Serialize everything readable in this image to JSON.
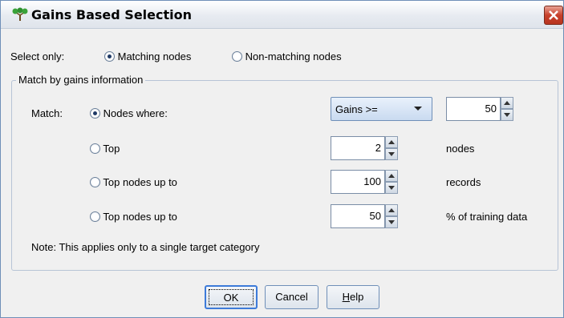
{
  "window": {
    "title": "Gains Based Selection"
  },
  "select_only": {
    "label": "Select only:",
    "options": [
      {
        "label": "Matching nodes",
        "checked": true
      },
      {
        "label": "Non-matching nodes",
        "checked": false
      }
    ]
  },
  "group": {
    "title": "Match by gains information",
    "match_label": "Match:",
    "rows": [
      {
        "label": "Nodes where:",
        "checked": true,
        "combo": "Gains >=",
        "value": "50"
      },
      {
        "label": "Top",
        "checked": false,
        "value": "2",
        "unit": "nodes"
      },
      {
        "label": "Top nodes up to",
        "checked": false,
        "value": "100",
        "unit": "records"
      },
      {
        "label": "Top nodes up to",
        "checked": false,
        "value": "50",
        "unit": "% of training data"
      }
    ],
    "note": "Note: This applies only to a single target category"
  },
  "buttons": {
    "ok": "OK",
    "cancel": "Cancel",
    "help_prefix": "H",
    "help_rest": "elp"
  },
  "icons": {
    "title": "tree-icon",
    "close": "close-icon"
  },
  "colors": {
    "accent": "#3d7bd9",
    "close": "#c7402b"
  }
}
